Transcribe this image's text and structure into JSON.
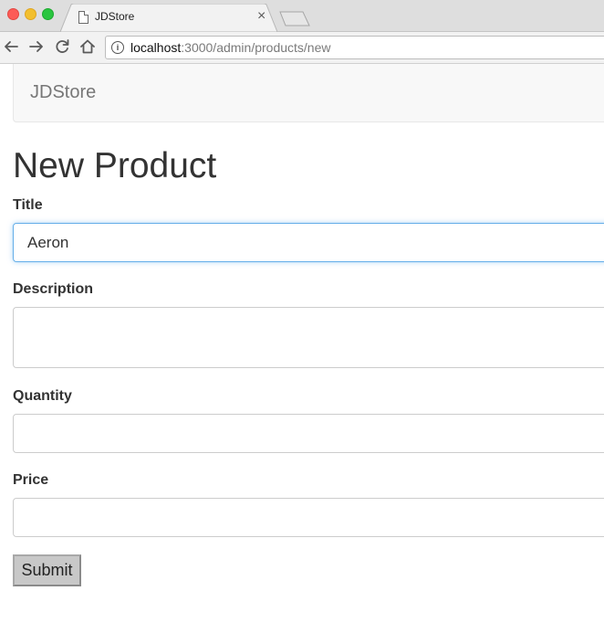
{
  "browser": {
    "tab_title": "JDStore",
    "tab_close_glyph": "×",
    "url_host": "localhost",
    "url_rest": ":3000/admin/products/new",
    "info_glyph": "i"
  },
  "navbar": {
    "brand": "JDStore"
  },
  "form": {
    "heading": "New Product",
    "title_label": "Title",
    "title_value": "Aeron",
    "description_label": "Description",
    "description_value": "",
    "quantity_label": "Quantity",
    "quantity_value": "",
    "price_label": "Price",
    "price_value": "",
    "submit_label": "Submit"
  },
  "colors": {
    "focus_border": "#66afe9",
    "navbar_bg": "#f8f8f8",
    "brand_text": "#777777",
    "button_bg": "#c8c8c8"
  },
  "icons": {
    "back": "arrow-left-icon",
    "forward": "arrow-right-icon",
    "reload": "reload-icon",
    "home": "home-icon",
    "info": "info-icon",
    "page": "document-icon"
  }
}
